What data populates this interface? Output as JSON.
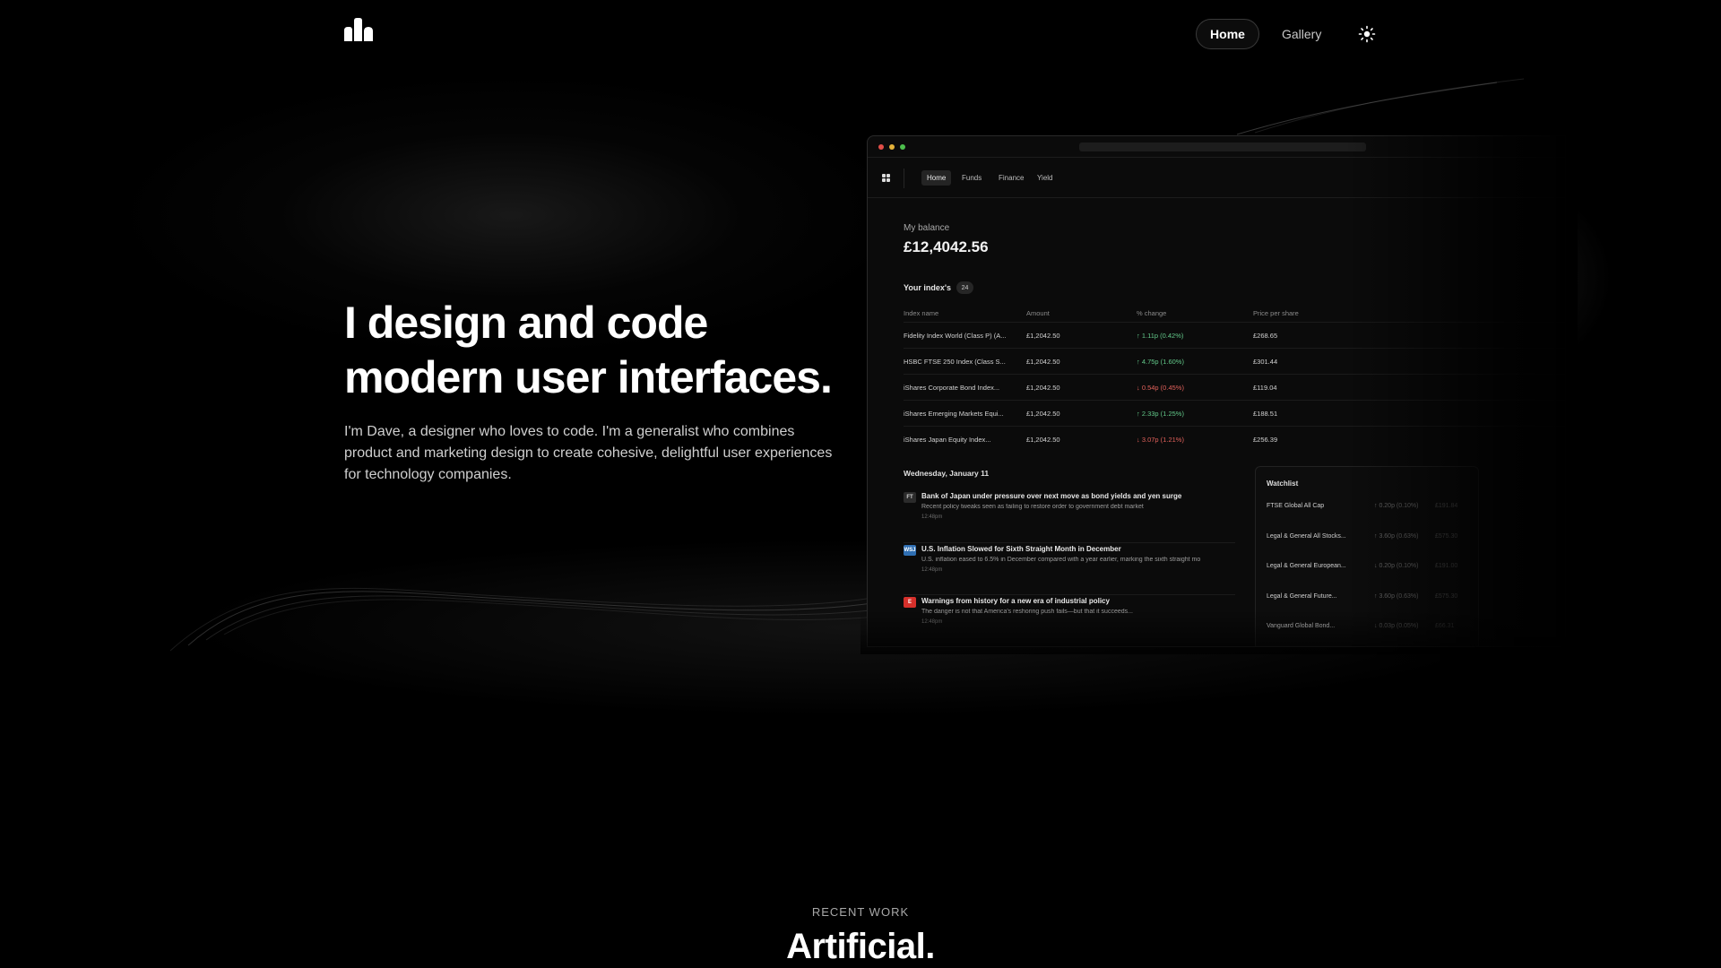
{
  "nav": {
    "logo_icon": "bars-logo-icon",
    "home_label": "Home",
    "gallery_label": "Gallery",
    "theme_icon": "sun-icon"
  },
  "hero": {
    "title_line1": "I design and code",
    "title_line2": "modern user interfaces.",
    "description": "I'm Dave, a designer who loves to code. I'm a generalist who combines product and marketing design to create cohesive, delightful user experiences for technology companies."
  },
  "mockup": {
    "tabs": [
      "Home",
      "Funds",
      "Finance",
      "Yield"
    ],
    "balance_label": "My balance",
    "balance_value": "£12,4042.56",
    "index_title": "Your index's",
    "index_count": "24",
    "columns": [
      "Index name",
      "Amount",
      "% change",
      "Price per share"
    ],
    "rows": [
      {
        "name": "Fidelity Index World (Class P) (A...",
        "amount": "£1,2042.50",
        "change": "↑ 1.11p (0.42%)",
        "direction": "up",
        "price": "£268.65"
      },
      {
        "name": "HSBC FTSE 250 Index (Class S...",
        "amount": "£1,2042.50",
        "change": "↑ 4.75p (1.60%)",
        "direction": "up",
        "price": "£301.44"
      },
      {
        "name": "iShares Corporate Bond Index...",
        "amount": "£1,2042.50",
        "change": "↓ 0.54p (0.45%)",
        "direction": "down",
        "price": "£119.04"
      },
      {
        "name": "iShares Emerging Markets Equi...",
        "amount": "£1,2042.50",
        "change": "↑ 2.33p (1.25%)",
        "direction": "up",
        "price": "£188.51"
      },
      {
        "name": "iShares Japan Equity Index...",
        "amount": "£1,2042.50",
        "change": "↓ 3.07p (1.21%)",
        "direction": "down",
        "price": "£256.39"
      }
    ],
    "news_date": "Wednesday, January 11",
    "news": [
      {
        "icon": "FT",
        "icon_bg": "#2b2b2b",
        "icon_color": "#cfcfcf",
        "title": "Bank of Japan under pressure over next move as bond yields and yen surge",
        "sub": "Recent policy tweaks seen as failing to restore order to government debt market",
        "time": "12:48pm"
      },
      {
        "icon": "WSJ",
        "icon_bg": "#2f6fb3",
        "icon_color": "#ffffff",
        "title": "U.S. Inflation Slowed for Sixth Straight Month in December",
        "sub": "U.S. inflation eased to 6.5% in December compared with a year earlier, marking the sixth straight mo",
        "time": "12:48pm"
      },
      {
        "icon": "E",
        "icon_bg": "#d6302b",
        "icon_color": "#ffffff",
        "title": "Warnings from history for a new era of industrial policy",
        "sub": "The danger is not that America's reshoring push fails—but that it succeeds...",
        "time": "12:48pm"
      }
    ],
    "watchlist_title": "Watchlist",
    "watchlist": [
      {
        "name": "FTSE Global All Cap",
        "change": "↑ 0.20p (0.10%)",
        "price": "£191.84"
      },
      {
        "name": "Legal & General All Stocks...",
        "change": "↑ 3.60p (0.63%)",
        "price": "£575.30"
      },
      {
        "name": "Legal & General European...",
        "change": "↓ 0.20p (0.10%)",
        "price": "£191.00"
      },
      {
        "name": "Legal & General Future...",
        "change": "↑ 3.60p (0.63%)",
        "price": "£575.30"
      },
      {
        "name": "Vanguard Global Bond...",
        "change": "↓ 0.03p (0.05%)",
        "price": "£66.31"
      }
    ]
  },
  "recent": {
    "label": "RECENT WORK",
    "title": "Artificial."
  },
  "colors": {
    "background": "#000000",
    "up": "#63c98a",
    "down": "#e2615b"
  }
}
